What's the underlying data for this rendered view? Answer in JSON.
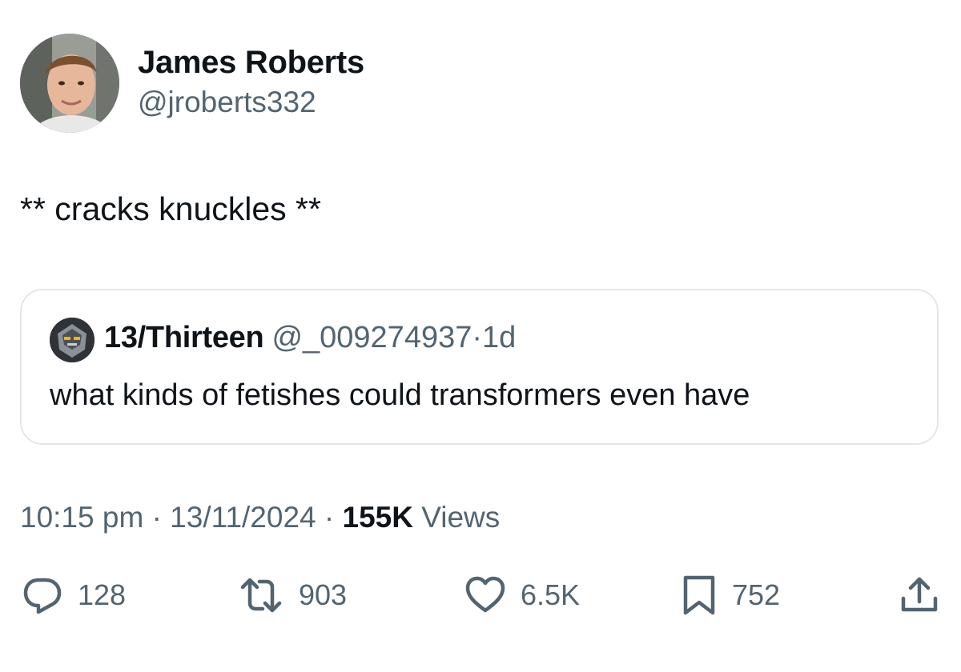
{
  "author": {
    "display_name": "James Roberts",
    "handle": "@jroberts332"
  },
  "tweet": {
    "text": "** cracks knuckles **"
  },
  "quoted_tweet": {
    "display_name": "13/Thirteen",
    "handle": "@_009274937",
    "separator": "·",
    "time_ago": "1d",
    "text": "what kinds of fetishes could transformers even have"
  },
  "meta": {
    "time": "10:15 pm",
    "separator": "·",
    "date": "13/11/2024",
    "views_count": "155K",
    "views_label": "Views"
  },
  "actions": {
    "reply": {
      "icon": "reply-icon",
      "count": "128"
    },
    "retweet": {
      "icon": "retweet-icon",
      "count": "903"
    },
    "like": {
      "icon": "heart-icon",
      "count": "6.5K"
    },
    "bookmark": {
      "icon": "bookmark-icon",
      "count": "752"
    },
    "share": {
      "icon": "share-icon"
    }
  },
  "colors": {
    "text_primary": "#0f1419",
    "text_secondary": "#536471",
    "border": "#e3e7ea",
    "background": "#ffffff"
  }
}
